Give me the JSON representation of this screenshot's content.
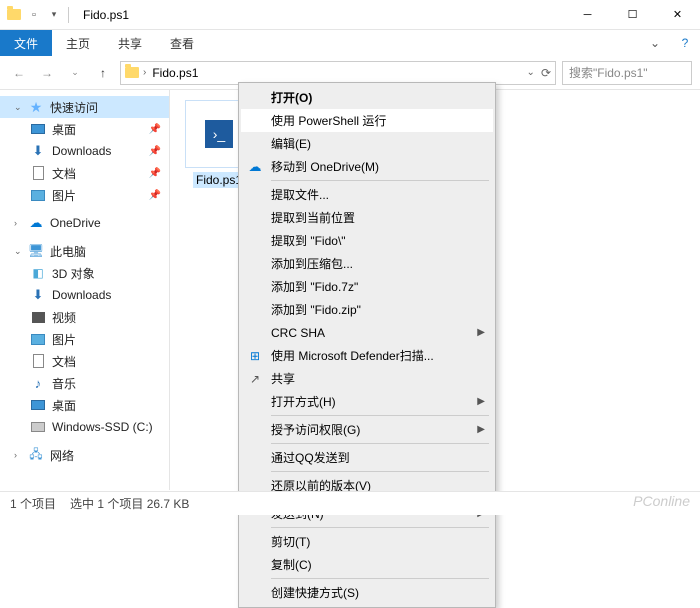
{
  "window": {
    "title": "Fido.ps1"
  },
  "ribbon": {
    "file": "文件",
    "home": "主页",
    "share": "共享",
    "view": "查看"
  },
  "address": {
    "crumb": "Fido.ps1",
    "search_placeholder": "搜索\"Fido.ps1\""
  },
  "sidebar": {
    "quick_access": "快速访问",
    "desktop": "桌面",
    "downloads": "Downloads",
    "documents": "文档",
    "pictures": "图片",
    "onedrive": "OneDrive",
    "this_pc": "此电脑",
    "objects3d": "3D 对象",
    "downloads2": "Downloads",
    "videos": "视频",
    "pictures2": "图片",
    "documents2": "文档",
    "music": "音乐",
    "desktop2": "桌面",
    "drive_c": "Windows-SSD (C:)",
    "network": "网络"
  },
  "file": {
    "name": "Fido.ps1"
  },
  "context_menu": {
    "open": "打开(O)",
    "run_ps": "使用 PowerShell 运行",
    "edit": "编辑(E)",
    "move_onedrive": "移动到 OneDrive(M)",
    "extract": "提取文件...",
    "extract_here": "提取到当前位置",
    "extract_to": "提取到 \"Fido\\\"",
    "add_archive": "添加到压缩包...",
    "add_7z": "添加到 \"Fido.7z\"",
    "add_zip": "添加到 \"Fido.zip\"",
    "crc_sha": "CRC SHA",
    "defender": "使用 Microsoft Defender扫描...",
    "share": "共享",
    "open_with": "打开方式(H)",
    "grant_access": "授予访问权限(G)",
    "send_qq": "通过QQ发送到",
    "restore": "还原以前的版本(V)",
    "send_to": "发送到(N)",
    "cut": "剪切(T)",
    "copy": "复制(C)",
    "create_shortcut": "创建快捷方式(S)"
  },
  "status": {
    "items": "1 个项目",
    "selected": "选中 1 个项目 26.7 KB"
  },
  "watermark": "PConline"
}
